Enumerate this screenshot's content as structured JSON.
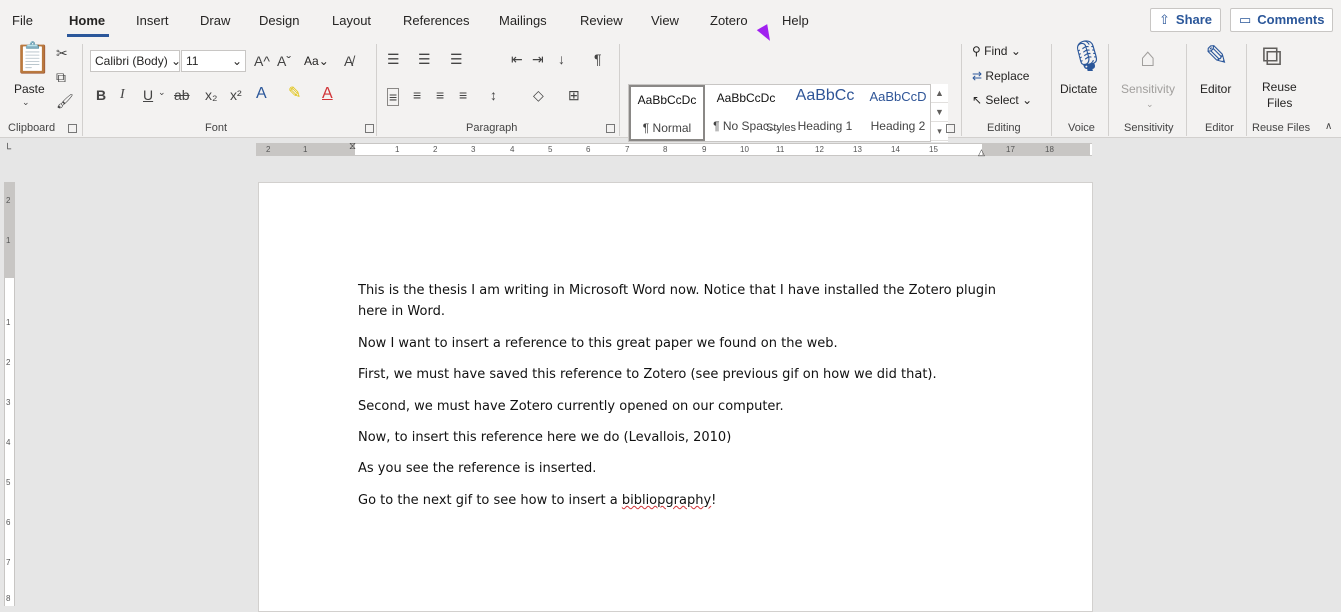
{
  "tabs": [
    {
      "label": "File"
    },
    {
      "label": "Home"
    },
    {
      "label": "Insert"
    },
    {
      "label": "Draw"
    },
    {
      "label": "Design"
    },
    {
      "label": "Layout"
    },
    {
      "label": "References"
    },
    {
      "label": "Mailings"
    },
    {
      "label": "Review"
    },
    {
      "label": "View"
    },
    {
      "label": "Zotero"
    },
    {
      "label": "Help"
    }
  ],
  "header": {
    "share": "Share",
    "comments": "Comments"
  },
  "clipboard": {
    "paste": "Paste",
    "label": "Clipboard"
  },
  "font": {
    "name": "Calibri (Body)",
    "size": "11",
    "label": "Font",
    "change_case": "Aa"
  },
  "paragraph": {
    "label": "Paragraph"
  },
  "styles": {
    "label": "Styles",
    "items": [
      {
        "sample": "AaBbCcDc",
        "name": "¶ Normal"
      },
      {
        "sample": "AaBbCcDc",
        "name": "¶ No Spac..."
      },
      {
        "sample": "AaBbCc",
        "name": "Heading 1"
      },
      {
        "sample": "AaBbCcD",
        "name": "Heading 2"
      }
    ]
  },
  "editing": {
    "find": "Find",
    "replace": "Replace",
    "select": "Select",
    "label": "Editing"
  },
  "voice": {
    "dictate": "Dictate",
    "label": "Voice"
  },
  "sensitivity": {
    "button": "Sensitivity",
    "label": "Sensitivity"
  },
  "editor": {
    "button": "Editor",
    "label": "Editor"
  },
  "reuse": {
    "button_line1": "Reuse",
    "button_line2": "Files",
    "label": "Reuse Files"
  },
  "ruler": {
    "h_ticks": [
      "2",
      "1",
      "1",
      "2",
      "3",
      "4",
      "5",
      "6",
      "7",
      "8",
      "9",
      "10",
      "11",
      "12",
      "13",
      "14",
      "15",
      "17",
      "18"
    ],
    "v_ticks": [
      "2",
      "1",
      "1",
      "2",
      "3",
      "4",
      "5",
      "6",
      "7",
      "8"
    ]
  },
  "document": {
    "paragraphs": [
      "This is the thesis I am writing in Microsoft Word now. Notice that I have installed the Zotero plugin",
      "here in Word.",
      "Now I want to insert a reference to this great paper we found on the web.",
      "First, we must have saved this reference to Zotero (see previous gif on how we did that).",
      "Second, we must have Zotero currently opened on our computer.",
      "Now, to insert this reference here we do (Levallois, 2010)",
      "As you see the reference is inserted.",
      "Go to the next gif to see how to insert a "
    ],
    "misspelled_word": "bibliopgraphy",
    "last_suffix": "!"
  },
  "colors": {
    "accent": "#2b579a",
    "cursor": "#a020f0",
    "misspell": "#d13438"
  }
}
